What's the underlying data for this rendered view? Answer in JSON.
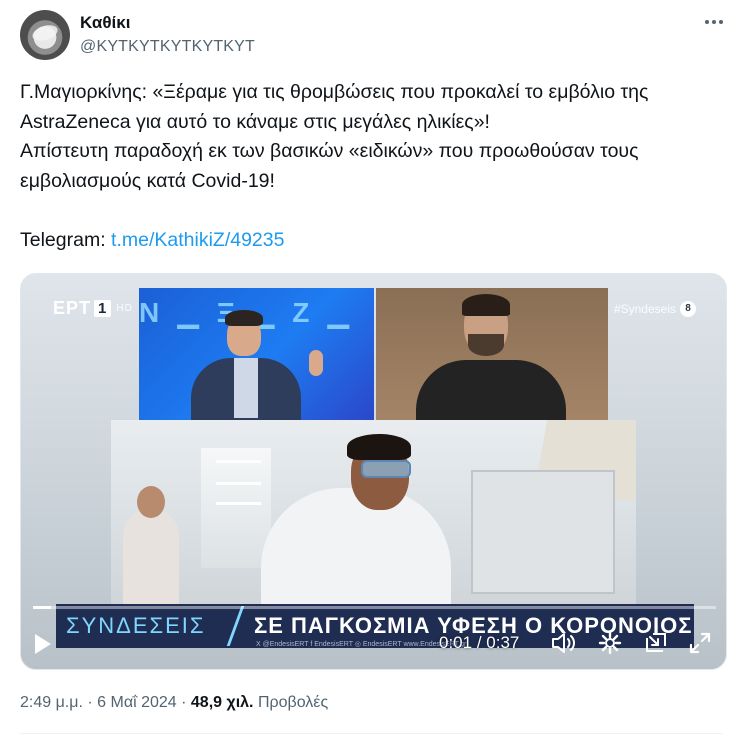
{
  "author": {
    "name": "Καθίκι",
    "handle": "@ΚΥΤΚΥΤΚΥΤΚΥΤΚΥΤ",
    "avatar_icon": "pot-avatar-icon"
  },
  "tweet": {
    "lines": [
      "Γ.Μαγιορκίνης: «Ξέραμε για τις θρομβώσεις που προκαλεί το εμβόλιο της",
      "AstraZeneca για αυτό το κάναμε στις μεγάλες ηλικίες»!",
      "Απίστευτη παραδοχή εκ των βασικών «ειδικών» που προωθούσαν τους",
      "εμβολιασμούς κατά Covid-19!"
    ],
    "telegram_label": "Telegram:",
    "telegram_link": "t.me/KathikiZ/49235"
  },
  "video": {
    "channel": "ΕΡΤ",
    "channel_number": "1",
    "channel_hd": "HD",
    "hashtag": "#Syndeseis",
    "hashtag_badge": "8",
    "banner_brand": "ΣΥΝΔΕΣΕΙΣ",
    "banner_text": "ΣΕ ΠΑΓΚΟΣΜΙΑ ΥΦΕΣΗ Ο ΚΟΡΟΝΟΙΟΣ",
    "banner_footer": "X @EndesisERT   f EndesisERT   ◎ EndesisERT   www.EndesisERT.gr",
    "current_time": "0:01",
    "separator": "/",
    "duration": "0:37",
    "progress": 0.027,
    "accent_color": "#7fd6ff"
  },
  "meta": {
    "time": "2:49 μ.μ.",
    "dot": "·",
    "date": "6 Μαΐ 2024",
    "views_count": "48,9 χιλ.",
    "views_label": "Προβολές"
  },
  "colors": {
    "link": "#1d9bf0",
    "secondary": "#536471",
    "primary": "#0f1419"
  }
}
